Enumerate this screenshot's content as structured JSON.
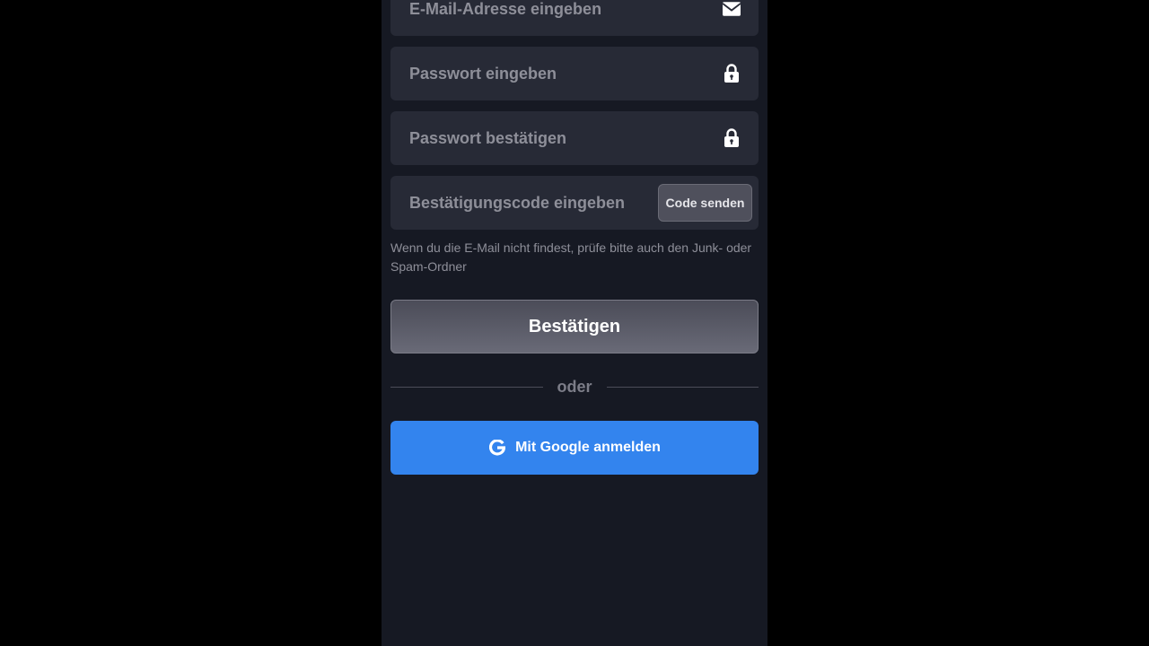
{
  "form": {
    "email_placeholder": "E-Mail-Adresse eingeben",
    "password_placeholder": "Passwort eingeben",
    "password_confirm_placeholder": "Passwort bestätigen",
    "code_placeholder": "Bestätigungscode eingeben",
    "send_code_label": "Code senden",
    "hint_text": "Wenn du die E-Mail nicht findest, prüfe bitte auch den Junk- oder Spam-Ordner",
    "confirm_label": "Bestätigen",
    "divider_text": "oder",
    "google_label": "Mit Google anmelden"
  },
  "icons": {
    "email": "envelope-icon",
    "password": "lock-icon",
    "password_confirm": "lock-icon",
    "google": "google-icon"
  },
  "colors": {
    "panel_background": "#161923",
    "field_background": "#272a36",
    "google_button": "#3384ee"
  }
}
